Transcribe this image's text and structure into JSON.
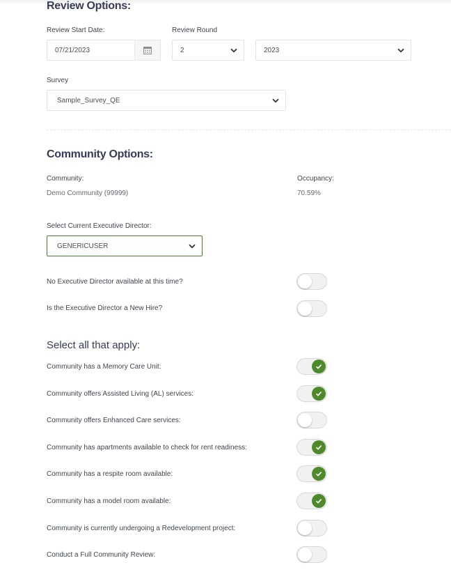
{
  "review": {
    "title": "Review Options:",
    "start_date_label": "Review Start Date:",
    "start_date_value": "07/21/2023",
    "round_label": "Review Round",
    "round_value": "2",
    "year_value": "2023",
    "survey_label": "Survey",
    "survey_value": "Sample_Survey_QE"
  },
  "community": {
    "title": "Community Options:",
    "community_label": "Community:",
    "community_value": "Demo Community (99999)",
    "occupancy_label": "Occupancy:",
    "occupancy_value": "70.59%",
    "director_label": "Select Current Executive Director:",
    "director_value": "GENERICUSER",
    "no_director_label": "No Executive Director available at this time?",
    "no_director_on": false,
    "new_hire_label": "Is the Executive Director a New Hire?",
    "new_hire_on": false
  },
  "apply": {
    "title": "Select all that apply:",
    "items": [
      {
        "label": "Community has a Memory Care Unit:",
        "on": true
      },
      {
        "label": "Community offers Assisted Living (AL) services:",
        "on": true
      },
      {
        "label": "Community offers Enhanced Care services:",
        "on": false
      },
      {
        "label": "Community has apartments available to check for rent readiness:",
        "on": true
      },
      {
        "label": "Community has a respite room available:",
        "on": true
      },
      {
        "label": "Community has a model room available:",
        "on": true
      },
      {
        "label": "Community is currently undergoing a Redevelopment project:",
        "on": false
      },
      {
        "label": "Conduct a Full Community Review:",
        "on": false
      }
    ]
  },
  "colors": {
    "accent": "#4e8a2b",
    "heading": "#363b57",
    "director_border": "#4e7a2e"
  },
  "icons": {
    "calendar": "calendar-icon",
    "chevron": "chevron-down-icon",
    "check": "check-icon"
  }
}
